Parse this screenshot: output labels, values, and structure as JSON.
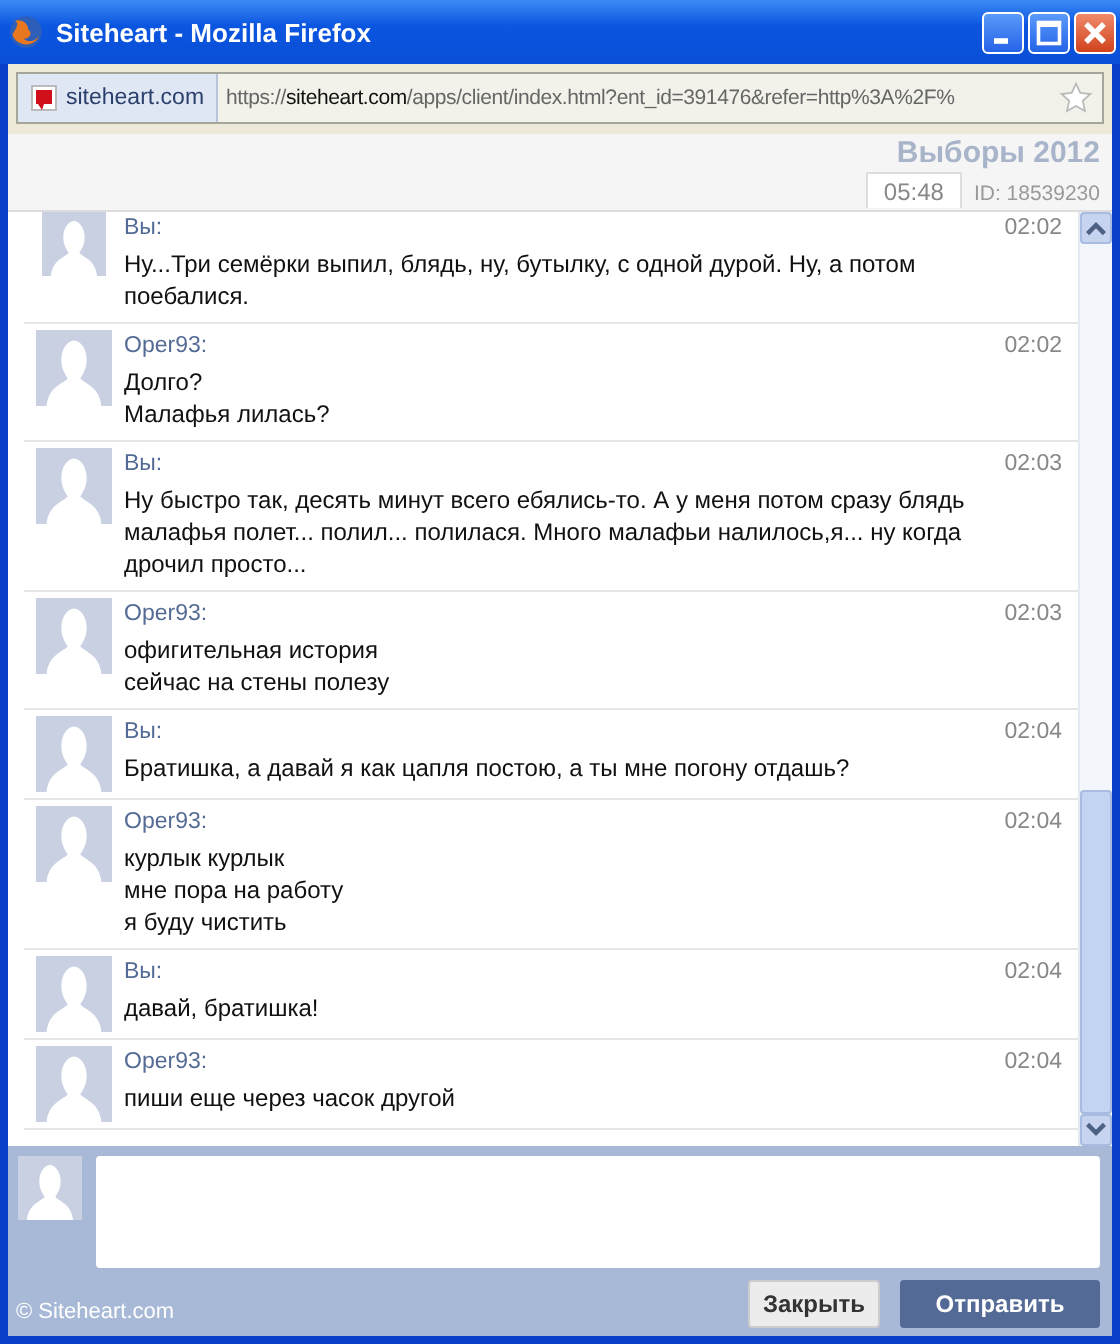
{
  "window": {
    "title": "Siteheart - Mozilla Firefox"
  },
  "address_bar": {
    "site": "siteheart.com",
    "url_prefix": "https://",
    "url_host": "siteheart.com",
    "url_rest": "/apps/client/index.html?ent_id=391476&refer=http%3A%2F%"
  },
  "header": {
    "title": "Выборы 2012",
    "id": "ID: 18539230",
    "time": "05:48"
  },
  "messages": [
    {
      "author": "Вы:",
      "time": "02:02",
      "lines": [
        "Ну...Три семёрки выпил, блядь, ну, бутылку, с одной дурой. Ну, а потом поебалися."
      ]
    },
    {
      "author": "Oper93:",
      "time": "02:02",
      "lines": [
        "Долго?",
        "Малафья лилась?"
      ]
    },
    {
      "author": "Вы:",
      "time": "02:03",
      "lines": [
        "Ну быстро так, десять минут всего ебялись-то. А у меня потом сразу блядь малафья полет... полил... полилася. Много малафьи налилось,я... ну когда дрочил просто..."
      ]
    },
    {
      "author": "Oper93:",
      "time": "02:03",
      "lines": [
        "офигительная история",
        "сейчас на стены полезу"
      ]
    },
    {
      "author": "Вы:",
      "time": "02:04",
      "lines": [
        "Братишка, а давай я как цапля постою, а ты мне погону отдашь?"
      ]
    },
    {
      "author": "Oper93:",
      "time": "02:04",
      "lines": [
        "курлык курлык",
        "мне пора на работу",
        "я буду чистить"
      ]
    },
    {
      "author": "Вы:",
      "time": "02:04",
      "lines": [
        "давай, братишка!"
      ]
    },
    {
      "author": "Oper93:",
      "time": "02:04",
      "lines": [
        "пиши еще через часок другой"
      ]
    }
  ],
  "buttons": [
    {
      "label": "Закрыть",
      "kind": "secondary"
    },
    {
      "label": "Отправить",
      "kind": "primary"
    }
  ],
  "footer": {
    "copyright": "© Siteheart.com"
  }
}
